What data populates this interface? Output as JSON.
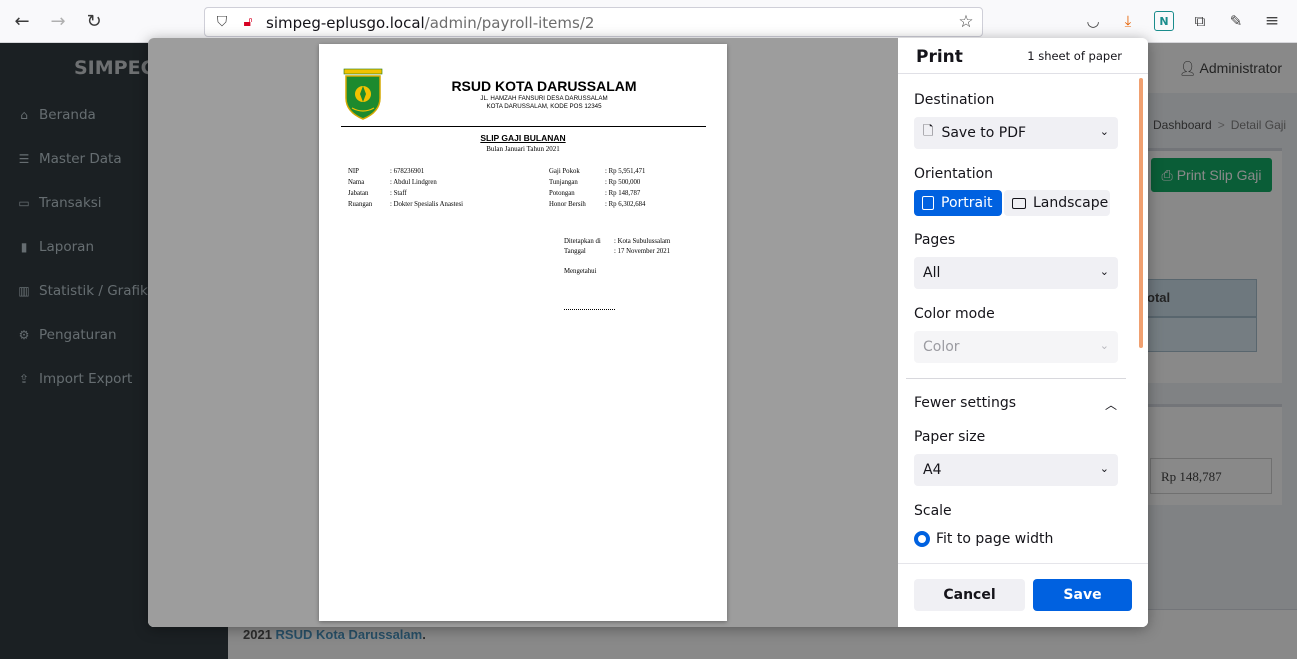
{
  "browser": {
    "url_host": "simpeg-eplusgo.local",
    "url_path": "/admin/payroll-items/2"
  },
  "app": {
    "brand": "SIMPEG",
    "user": "Administrator",
    "sidebar": [
      {
        "label": "Beranda",
        "icon": "home-icon"
      },
      {
        "label": "Master Data",
        "icon": "sliders-icon"
      },
      {
        "label": "Transaksi",
        "icon": "inbox-icon"
      },
      {
        "label": "Laporan",
        "icon": "book-icon"
      },
      {
        "label": "Statistik / Grafik",
        "icon": "bar-chart-icon"
      },
      {
        "label": "Pengaturan",
        "icon": "gear-icon"
      },
      {
        "label": "Import Export",
        "icon": "upload-icon"
      }
    ],
    "breadcrumb": {
      "home": "Dashboard",
      "current": "Detail Gaji"
    },
    "print_button": "Print Slip Gaji",
    "table_header_total": "otal",
    "potongan_value": "Rp 148,787",
    "footer_year": "2021",
    "footer_org": "RSUD Kota Darussalam"
  },
  "print": {
    "title": "Print",
    "sheets": "1 sheet of paper",
    "destination_label": "Destination",
    "destination_value": "Save to PDF",
    "orientation_label": "Orientation",
    "portrait": "Portrait",
    "landscape": "Landscape",
    "pages_label": "Pages",
    "pages_value": "All",
    "color_label": "Color mode",
    "color_value": "Color",
    "fewer_settings": "Fewer settings",
    "paper_size_label": "Paper size",
    "paper_size_value": "A4",
    "scale_label": "Scale",
    "fit_page": "Fit to page width",
    "cancel": "Cancel",
    "save": "Save"
  },
  "slip": {
    "org_name": "RSUD KOTA DARUSSALAM",
    "logo_text": "KOTA SUBULUSSALAM",
    "address1": "JL. HAMZAH FANSURI DESA DARUSSALAM",
    "address2": "KOTA DARUSSALAM, KODE POS 12345",
    "title": "SLIP GAJI BULANAN",
    "period": "Bulan Januari Tahun 2021",
    "left": [
      {
        "label": "NIP",
        "value": ": 678236901"
      },
      {
        "label": "Nama",
        "value": ": Abdul Lindgren"
      },
      {
        "label": "Jabatan",
        "value": ": Staff"
      },
      {
        "label": "Ruangan",
        "value": ": Dokter Spesialis Anastesi"
      }
    ],
    "right": [
      {
        "label": "Gaji Pokok",
        "value": ": Rp 5,951,471"
      },
      {
        "label": "Tunjangan",
        "value": ": Rp 500,000"
      },
      {
        "label": "Potongan",
        "value": ": Rp 148,787"
      },
      {
        "label": "Honor Bersih",
        "value": ": Rp 6,302,684"
      }
    ],
    "ditetapkan_label": "Ditetapkan di",
    "ditetapkan_value": ":  Kota Subulussalam",
    "tanggal_label": "Tanggal",
    "tanggal_value": ":  17 November 2021",
    "mengetahui": "Mengetahui"
  },
  "colors": {
    "primary_blue": "#0061e0",
    "success_green": "#00a65a",
    "sidebar_dark": "#222d32",
    "scrollbar_orange": "#f0a070"
  }
}
